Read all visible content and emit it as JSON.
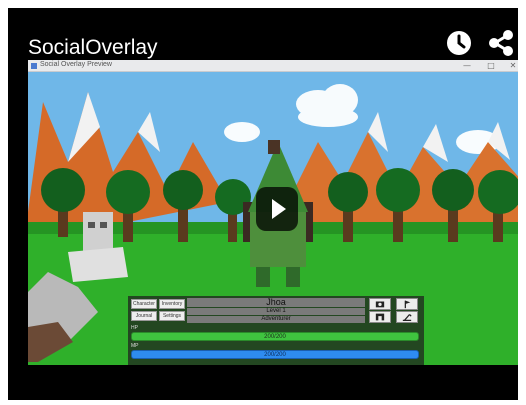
{
  "player": {
    "title": "SocialOverlay",
    "watch_later_icon": "clock-icon",
    "share_icon": "share-icon",
    "play_icon": "play-icon"
  },
  "app_window": {
    "title": "Social Overlay Preview",
    "minimize": "—",
    "maximize": "□",
    "close": "✕"
  },
  "hud": {
    "buttons": {
      "character": "Character",
      "inventory": "Inventory",
      "journal": "Journal",
      "settings": "Settings"
    },
    "player_name": "Jhoa",
    "level": "Level 1",
    "class": "Adventurer",
    "hp_label": "HP",
    "hp_value": "200/200",
    "hp_fraction": 1.0,
    "mp_label": "MP",
    "mp_value": "200/200",
    "mp_fraction": 1.0,
    "icons": [
      "camera-icon",
      "flag-icon",
      "map-icon",
      "tool-icon"
    ]
  },
  "colors": {
    "sky": "#6fb7e8",
    "grass": "#2fb02a",
    "mountain": "#d9722e",
    "hp_bar": "#3fc33f",
    "mp_bar": "#2e8cf0"
  }
}
